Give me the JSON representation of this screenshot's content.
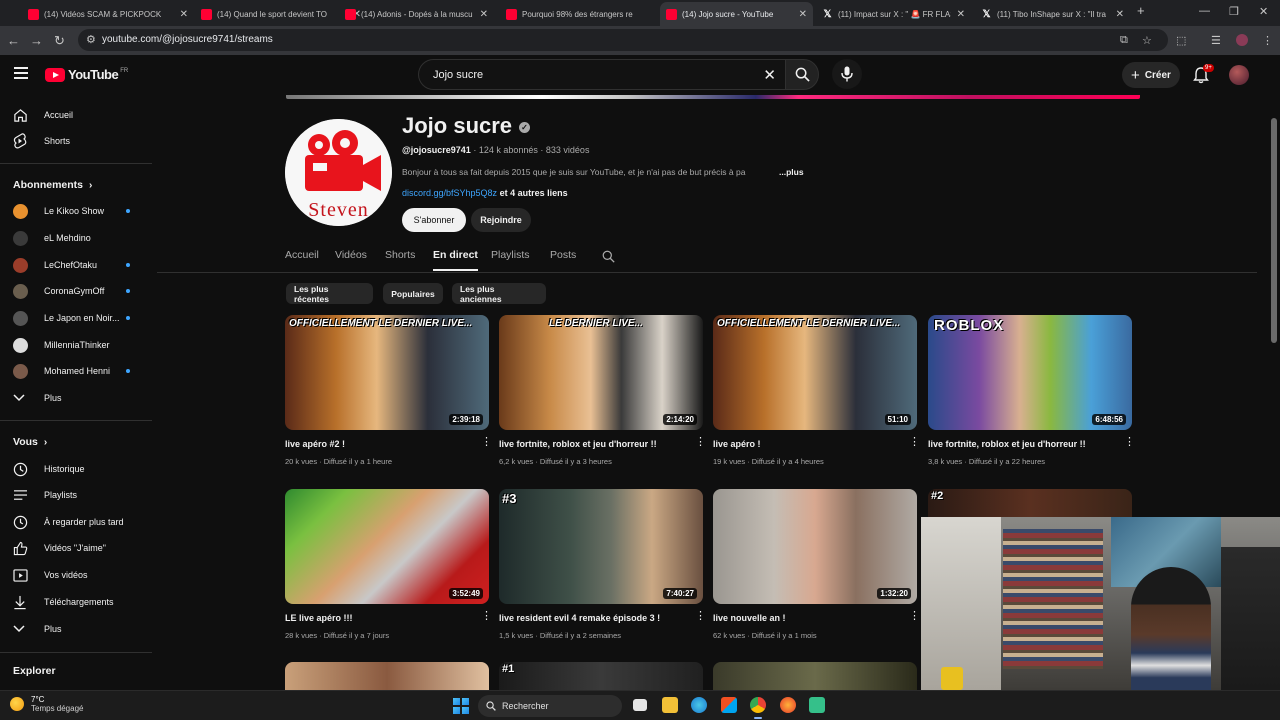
{
  "browser": {
    "tabs": [
      {
        "label": "(14) Vidéos SCAM & PICKPOCK",
        "icon": "youtube-icon"
      },
      {
        "label": "(14) Quand le sport devient TO",
        "icon": "youtube-icon"
      },
      {
        "label": "(14) Adonis - Dopés à la muscu",
        "icon": "youtube-icon"
      },
      {
        "label": "Pourquoi 98% des étrangers re",
        "icon": "youtube-icon"
      },
      {
        "label": "(14) Jojo sucre - YouTube",
        "icon": "youtube-icon",
        "active": true
      },
      {
        "label": "(11) Impact sur X : \" 🚨 FR FLASH",
        "icon": "x-icon"
      },
      {
        "label": "(11) Tibo InShape sur X : \"Il tra",
        "icon": "x-icon"
      }
    ],
    "url": "youtube.com/@jojosucre9741/streams"
  },
  "header": {
    "logo_text": "YouTube",
    "logo_region": "FR",
    "search_value": "Jojo sucre",
    "create_label": "Créer",
    "notification_count": "9+"
  },
  "sidebar": {
    "main": [
      {
        "label": "Accueil",
        "icon": "home-icon"
      },
      {
        "label": "Shorts",
        "icon": "shorts-icon"
      }
    ],
    "subscriptions_heading": "Abonnements",
    "subscriptions": [
      {
        "label": "Le Kikoo Show",
        "color": "#e8912f",
        "new": true
      },
      {
        "label": "eL Mehdino",
        "color": "#3a3a3a",
        "new": false
      },
      {
        "label": "LeChefOtaku",
        "color": "#9b3d2a",
        "new": true
      },
      {
        "label": "CoronaGymOff",
        "color": "#6a5e4e",
        "new": true
      },
      {
        "label": "Le Japon en Noir...",
        "color": "#555555",
        "new": true
      },
      {
        "label": "MillenniaThinker",
        "color": "#dddddd",
        "new": false
      },
      {
        "label": "Mohamed Henni",
        "color": "#7a5a4a",
        "new": true
      }
    ],
    "subscriptions_more": "Plus",
    "you_heading": "Vous",
    "you": [
      {
        "label": "Historique",
        "icon": "history-icon"
      },
      {
        "label": "Playlists",
        "icon": "playlist-icon"
      },
      {
        "label": "À regarder plus tard",
        "icon": "watch-later-icon"
      },
      {
        "label": "Vidéos \"J'aime\"",
        "icon": "like-icon"
      },
      {
        "label": "Vos vidéos",
        "icon": "your-videos-icon"
      },
      {
        "label": "Téléchargements",
        "icon": "download-icon"
      },
      {
        "label": "Plus",
        "icon": "chevron-down-icon"
      }
    ],
    "explore_heading": "Explorer"
  },
  "channel": {
    "name": "Jojo sucre",
    "avatar_text": "Steven",
    "handle": "@jojosucre9741",
    "subscribers": "124 k abonnés",
    "videos": "833 vidéos",
    "description": "Bonjour à tous sa fait depuis 2015 que je suis sur YouTube, et je n'ai pas de but précis à pa",
    "more_label": "...plus",
    "link": "discord.gg/bfSYhp5Q8z",
    "other_links": "et 4 autres liens",
    "subscribe_label": "S'abonner",
    "join_label": "Rejoindre"
  },
  "tabs": [
    "Accueil",
    "Vidéos",
    "Shorts",
    "En direct",
    "Playlists",
    "Posts"
  ],
  "active_tab": "En direct",
  "chips": [
    "Les plus récentes",
    "Populaires",
    "Les plus anciennes"
  ],
  "videos": [
    {
      "title": "live apéro #2 !",
      "meta": "20 k vues · Diffusé il y a 1 heure",
      "duration": "2:39:18",
      "overlay": "OFFICIELLEMENT LE DERNIER LIVE..."
    },
    {
      "title": "live fortnite, roblox et jeu d'horreur !!",
      "meta": "6,2 k vues · Diffusé il y a 3 heures",
      "duration": "2:14:20",
      "overlay": "LE DERNIER LIVE..."
    },
    {
      "title": "live apéro !",
      "meta": "19 k vues · Diffusé il y a 4 heures",
      "duration": "51:10",
      "overlay": "OFFICIELLEMENT LE DERNIER LIVE..."
    },
    {
      "title": "live fortnite, roblox et jeu d'horreur !!",
      "meta": "3,8 k vues · Diffusé il y a 22 heures",
      "duration": "6:48:56",
      "overlay": "ROBLOX"
    },
    {
      "title": "LE live apéro !!!",
      "meta": "28 k vues · Diffusé il y a 7 jours",
      "duration": "3:52:49",
      "overlay": ""
    },
    {
      "title": "live resident evil 4 remake épisode 3 !",
      "meta": "1,5 k vues · Diffusé il y a 2 semaines",
      "duration": "7:40:27",
      "overlay": "#3"
    },
    {
      "title": "live nouvelle an !",
      "meta": "62 k vues · Diffusé il y a 1 mois",
      "duration": "1:32:20",
      "overlay": ""
    }
  ],
  "row3_badges": [
    "#2",
    "#1"
  ],
  "taskbar": {
    "temp": "7°C",
    "weather": "Temps dégagé",
    "search_label": "Rechercher"
  }
}
